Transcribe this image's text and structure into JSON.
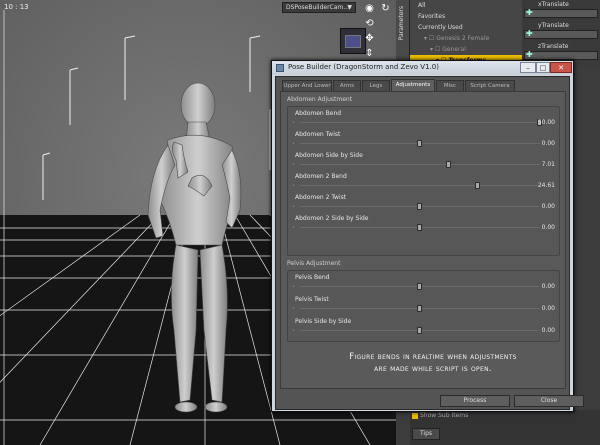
{
  "viewport": {
    "label": "10 : 13",
    "camera_dropdown": "DSPoseBuilderCam..."
  },
  "nav_cube": {
    "face_label": ""
  },
  "right_panel": {
    "side_tab": "Parameters",
    "tree": [
      "All",
      "Favorites",
      "Currently Used",
      "Genesis 2 Female",
      "General",
      "Transforms"
    ],
    "translate": [
      "xTranslate",
      "yTranslate",
      "zTranslate"
    ],
    "show_sub_items": "Show Sub Items",
    "tips_tab": "Tips"
  },
  "dialog": {
    "title": "Pose Builder (DragonStorm and Zevo V1.0)",
    "tabs": [
      "Upper And Lower",
      "Arms",
      "Legs",
      "Adjustments",
      "Misc",
      "Script Camera"
    ],
    "active_tab": "Adjustments",
    "groups": [
      {
        "title": "Abdomen Adjustment",
        "sliders": [
          {
            "label": "Abdomen Bend",
            "value": "50.00",
            "fraction": 1.0
          },
          {
            "label": "Abdomen Twist",
            "value": "0.00",
            "fraction": 0.5
          },
          {
            "label": "Abdomen Side by Side",
            "value": "7.01",
            "fraction": 0.62
          },
          {
            "label": "Abdomen 2 Bend",
            "value": "24.61",
            "fraction": 0.74
          },
          {
            "label": "Abdomen 2 Twist",
            "value": "0.00",
            "fraction": 0.5
          },
          {
            "label": "Abdomen 2 Side by Side",
            "value": "0.00",
            "fraction": 0.5
          }
        ]
      },
      {
        "title": "Pelvis Adjustment",
        "sliders": [
          {
            "label": "Pelvis Bend",
            "value": "0.00",
            "fraction": 0.5
          },
          {
            "label": "Pelvis Twist",
            "value": "0.00",
            "fraction": 0.5
          },
          {
            "label": "Pelvis Side by Side",
            "value": "0.00",
            "fraction": 0.5
          }
        ]
      }
    ],
    "note_line1": "Figure bends in realtime when adjustments",
    "note_line2": "are made while script is open.",
    "process_button": "Process",
    "close_button": "Close",
    "window_buttons": {
      "minimize": "–",
      "restore": "□",
      "close": "✕"
    }
  }
}
